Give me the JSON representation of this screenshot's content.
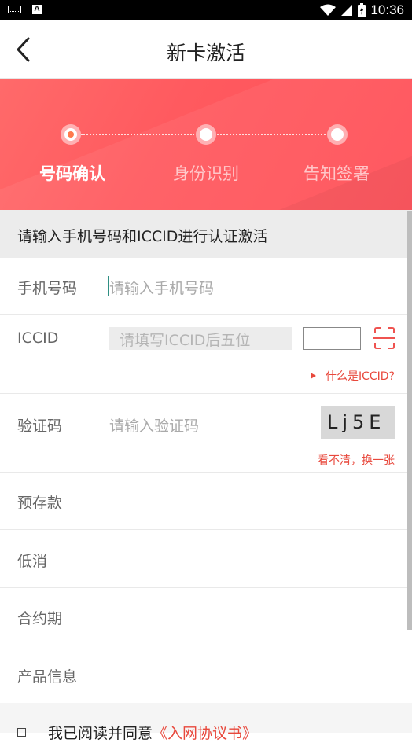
{
  "status_bar": {
    "time": "10:36",
    "left_icons": [
      "keyboard-icon",
      "a-icon"
    ],
    "right_icons": [
      "wifi-icon",
      "signal-icon",
      "battery-icon"
    ],
    "a_icon_letter": "A"
  },
  "header": {
    "title": "新卡激活",
    "back_icon": "chevron-left-icon"
  },
  "steps": [
    {
      "label": "号码确认",
      "active": true
    },
    {
      "label": "身份识别",
      "active": false
    },
    {
      "label": "告知签署",
      "active": false
    }
  ],
  "notice": "请输入手机号码和ICCID进行认证激活",
  "form": {
    "phone": {
      "label": "手机号码",
      "placeholder": "请输入手机号码",
      "value": ""
    },
    "iccid": {
      "label": "ICCID",
      "placeholder": "请填写ICCID后五位",
      "value": "",
      "help_link": "什么是ICCID?"
    },
    "captcha": {
      "label": "验证码",
      "placeholder": "请输入验证码",
      "image_text": "Lj5E",
      "refresh_link": "看不清，换一张"
    },
    "prepayment": {
      "label": "预存款"
    },
    "min_consumption": {
      "label": "低消"
    },
    "contract_period": {
      "label": "合约期"
    },
    "product_info": {
      "label": "产品信息"
    }
  },
  "agreement": {
    "prefix": "我已阅读并同意",
    "link": "《入网协议书》"
  },
  "colors": {
    "accent": "#e8483c",
    "banner": "#ff5a5f"
  }
}
